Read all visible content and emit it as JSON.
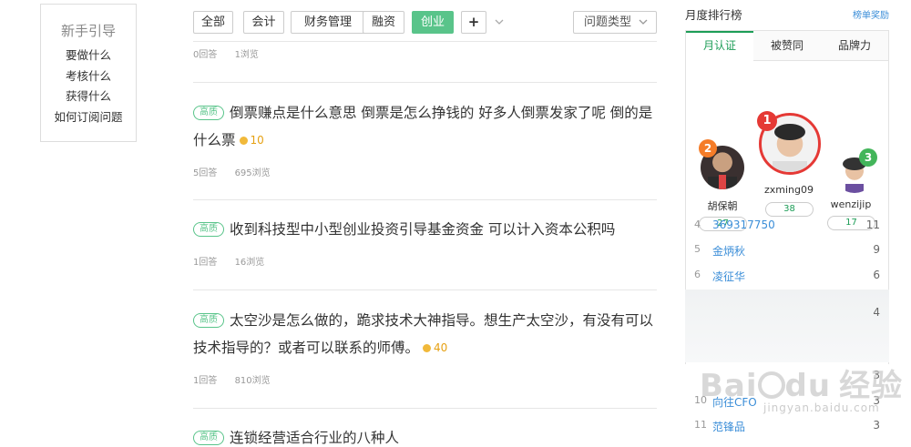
{
  "guide": {
    "title": "新手引导",
    "links": [
      "要做什么",
      "考核什么",
      "获得什么",
      "如何订阅问题"
    ]
  },
  "filters": {
    "tags": [
      "全部",
      "会计",
      "财务管理",
      "融资",
      "创业",
      "+"
    ],
    "active": "创业",
    "question_type": "问题类型"
  },
  "top_meta": {
    "answers": "0回答",
    "views": "1浏览"
  },
  "questions": [
    {
      "badge": "高质",
      "title": "倒票赚点是什么意思 倒票是怎么挣钱的 好多人倒票发家了呢 倒的是什么票",
      "reward": "10",
      "answers": "5回答",
      "views": "695浏览"
    },
    {
      "badge": "高质",
      "title": "收到科技型中小型创业投资引导基金资金 可以计入资本公积吗",
      "reward": "",
      "answers": "1回答",
      "views": "16浏览"
    },
    {
      "badge": "高质",
      "title": "太空沙是怎么做的，跪求技术大神指导。想生产太空沙，有没有可以技术指导的？或者可以联系的师傅。",
      "reward": "40",
      "answers": "1回答",
      "views": "810浏览"
    },
    {
      "badge": "高质",
      "title": "连锁经营适合行业的八种人",
      "reward": "",
      "answers": "",
      "views": ""
    }
  ],
  "rank": {
    "title": "月度排行榜",
    "rule_link": "榜单奖励",
    "tabs": [
      "月认证",
      "被赞同",
      "品牌力"
    ],
    "active_tab": "月认证",
    "podium": [
      {
        "rank": "1",
        "name": "zxming09",
        "score": "38"
      },
      {
        "rank": "2",
        "name": "胡保朝",
        "score": "27"
      },
      {
        "rank": "3",
        "name": "wenzijip",
        "score": "17"
      }
    ],
    "rows": [
      {
        "n": "4",
        "name": "369317750",
        "score": "11"
      },
      {
        "n": "5",
        "name": "金炳秋",
        "score": "9"
      },
      {
        "n": "6",
        "name": "凌征华",
        "score": "6"
      },
      {
        "n": "",
        "name": "",
        "score": "4"
      },
      {
        "n": "",
        "name": "",
        "score": "3"
      },
      {
        "n": "10",
        "name": "向往CFO",
        "score": "3"
      },
      {
        "n": "11",
        "name": "范锋品",
        "score": "3"
      }
    ]
  },
  "watermark": {
    "brand": "Bai",
    "brand2": "du",
    "cn": "经验",
    "url": "jingyan.baidu.com"
  },
  "colors": {
    "accent": "#59c48a",
    "link": "#3b8ed8",
    "gold": "#f1b93a",
    "rank1": "#e53935",
    "rank2": "#f57c28",
    "rank3": "#43b55a"
  }
}
